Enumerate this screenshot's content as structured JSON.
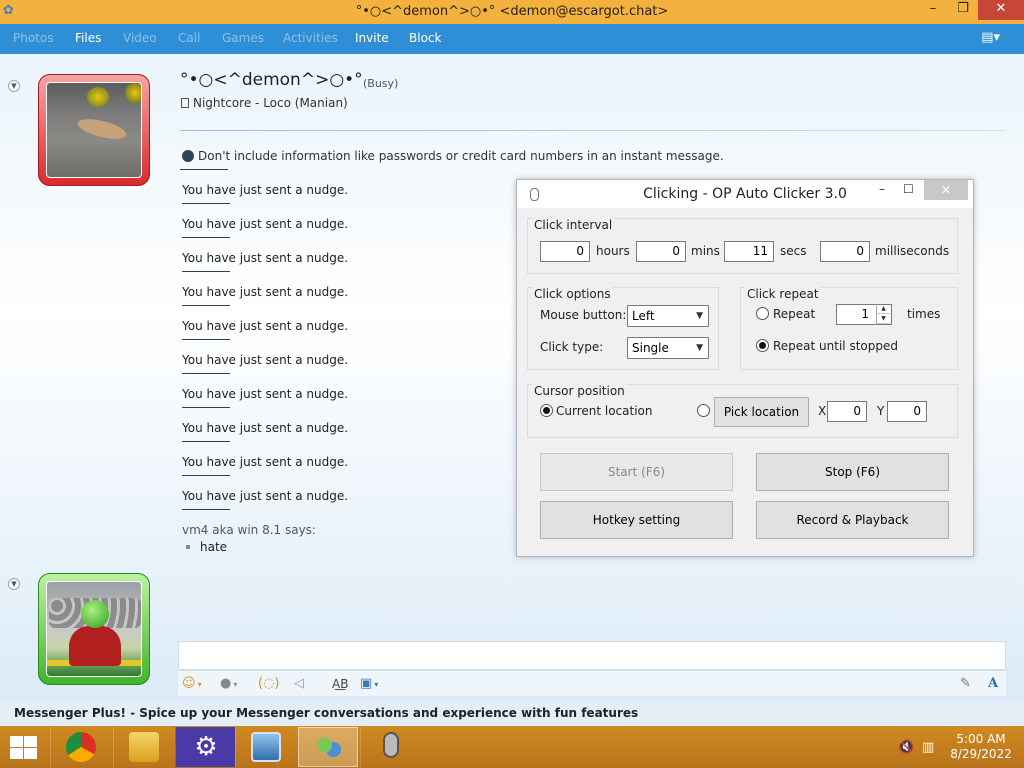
{
  "window": {
    "title": "°•○<^demon^>○•° <demon@escargot.chat>",
    "buttons": {
      "minimize": "–",
      "maximize": "❐",
      "close": "✕"
    }
  },
  "menu": {
    "items": [
      {
        "label": "Photos",
        "enabled": false
      },
      {
        "label": "Files",
        "enabled": true
      },
      {
        "label": "Video",
        "enabled": false
      },
      {
        "label": "Call",
        "enabled": false
      },
      {
        "label": "Games",
        "enabled": false
      },
      {
        "label": "Activities",
        "enabled": false
      },
      {
        "label": "Invite",
        "enabled": true
      },
      {
        "label": "Block",
        "enabled": true
      }
    ]
  },
  "contact": {
    "name": "°•○<^demon^>○•°",
    "status": "(Busy)",
    "personal_message": "Nightcore - Loco (Manian)"
  },
  "conversation": {
    "warning": "Don't include information like passwords or credit card numbers in an instant message.",
    "nudges": [
      "You have just sent a nudge.",
      "You have just sent a nudge.",
      "You have just sent a nudge.",
      "You have just sent a nudge.",
      "You have just sent a nudge.",
      "You have just sent a nudge.",
      "You have just sent a nudge.",
      "You have just sent a nudge.",
      "You have just sent a nudge.",
      "You have just sent a nudge."
    ],
    "sender_line": "vm4 aka win 8.1 says:",
    "message": "hate"
  },
  "toolbar": {
    "emoticon": "☺",
    "wink": "●",
    "nudge": "(◌)",
    "voice_clip": "◁",
    "font": "A͟B",
    "background": "▣",
    "handwriting": "✎",
    "text_style": "A"
  },
  "plus_bar": {
    "text": "Messenger Plus! - Spice up your Messenger conversations and experience with fun features"
  },
  "taskbar": {
    "time": "5:00 AM",
    "date": "8/29/2022"
  },
  "clicker": {
    "title": "Clicking - OP Auto Clicker 3.0",
    "click_interval": {
      "label": "Click interval",
      "hours": "0",
      "hours_label": "hours",
      "mins": "0",
      "mins_label": "mins",
      "secs": "11",
      "secs_label": "secs",
      "ms": "0",
      "ms_label": "milliseconds"
    },
    "click_options": {
      "label": "Click options",
      "mouse_button_label": "Mouse button:",
      "mouse_button": "Left",
      "click_type_label": "Click type:",
      "click_type": "Single"
    },
    "click_repeat": {
      "label": "Click repeat",
      "repeat_label": "Repeat",
      "repeat_times": "1",
      "times_label": "times",
      "until_stopped_label": "Repeat until stopped"
    },
    "cursor_position": {
      "label": "Cursor position",
      "current_label": "Current location",
      "pick_button": "Pick location",
      "x_label": "X",
      "x": "0",
      "y_label": "Y",
      "y": "0"
    },
    "buttons": {
      "start": "Start (F6)",
      "stop": "Stop (F6)",
      "hotkey": "Hotkey setting",
      "record": "Record & Playback"
    }
  }
}
